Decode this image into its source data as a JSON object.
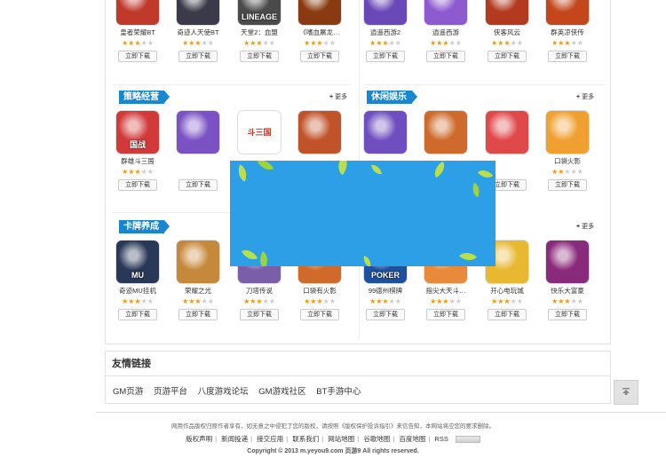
{
  "sections": [
    {
      "title": "",
      "more": "更多"
    },
    {
      "title": "策略经营",
      "more": "更多"
    },
    {
      "title": "休闲娱乐",
      "more": "更多"
    },
    {
      "title": "卡牌养成",
      "more": "更多"
    }
  ],
  "rows": {
    "row1": [
      {
        "name": "皇者荣耀BT",
        "stars": 3,
        "color": "#c0392b",
        "glyph": ""
      },
      {
        "name": "奇迹人天使BT",
        "stars": 3,
        "color": "#3a3a4a",
        "glyph": ""
      },
      {
        "name": "天堂2：血盟",
        "stars": 3,
        "color": "#4b4b4b",
        "glyph": "LINEAGE"
      },
      {
        "name": "《嗜血屠龙…",
        "stars": 3,
        "color": "#8a3a10",
        "glyph": ""
      },
      {
        "name": "逍遥西游2",
        "stars": 3,
        "color": "#6a48b8",
        "glyph": ""
      },
      {
        "name": "逍遥西游",
        "stars": 3,
        "color": "#8e5ad0",
        "glyph": ""
      },
      {
        "name": "侠客风云",
        "stars": 3,
        "color": "#b33a1e",
        "glyph": ""
      },
      {
        "name": "群英凉侠传",
        "stars": 3,
        "color": "#c4461c",
        "glyph": ""
      }
    ],
    "row2": [
      {
        "name": "群雄斗三国",
        "stars": 3,
        "color": "#d23a3a",
        "glyph": "国战"
      },
      {
        "name": "",
        "stars": 0,
        "color": "#7b52c4",
        "glyph": ""
      },
      {
        "name": "",
        "stars": 0,
        "color": "#ffffff",
        "glyph": "斗三国"
      },
      {
        "name": "",
        "stars": 0,
        "color": "#c0532a",
        "glyph": ""
      },
      {
        "name": "",
        "stars": 0,
        "color": "#6f4fc0",
        "glyph": ""
      },
      {
        "name": "",
        "stars": 0,
        "color": "#cd6a2c",
        "glyph": ""
      },
      {
        "name": "",
        "stars": 0,
        "color": "#e0484a",
        "glyph": ""
      },
      {
        "name": "口袋火影",
        "stars": 2,
        "color": "#f0a030",
        "glyph": ""
      }
    ],
    "row3": [
      {
        "name": "奇迹MU挂机",
        "stars": 3,
        "color": "#2a3858",
        "glyph": "MU"
      },
      {
        "name": "荣耀之光",
        "stars": 3,
        "color": "#c6883a",
        "glyph": ""
      },
      {
        "name": "刀塔传说",
        "stars": 3,
        "color": "#7a5ea8",
        "glyph": ""
      },
      {
        "name": "口袋有火影",
        "stars": 3,
        "color": "#d06a2a",
        "glyph": ""
      },
      {
        "name": "99德州棋牌",
        "stars": 3,
        "color": "#1e50a0",
        "glyph": "POKER"
      },
      {
        "name": "指尖大天斗…",
        "stars": 3,
        "color": "#e88a3a",
        "glyph": ""
      },
      {
        "name": "开心电玩城",
        "stars": 3,
        "color": "#e8b830",
        "glyph": ""
      },
      {
        "name": "快乐大富豪",
        "stars": 3,
        "color": "#8a2a7a",
        "glyph": ""
      }
    ]
  },
  "download_label": "立即下载",
  "links": {
    "title": "友情链接",
    "items": [
      "GM页游",
      "页游平台",
      "八度游戏论坛",
      "GM游戏社区",
      "BT手游中心"
    ]
  },
  "footer": {
    "notice": "网用作品版权归原作者享有，如无意之中侵犯了您的版权，请按照《版权保护投诉指引》来信告知，本网站将应您的要求删除。",
    "nav": [
      "版权声明",
      "新闻投递",
      "接交应用",
      "联系我们",
      "网站地图",
      "谷歌地图",
      "百度地图",
      "RSS"
    ],
    "copyright": "Copyright © 2013  m.yeyou9.com  页游9  All rights reserved."
  },
  "colors": {
    "accent": "#1a86d0",
    "star": "#f39800",
    "overlay": "#2c9fe6"
  }
}
